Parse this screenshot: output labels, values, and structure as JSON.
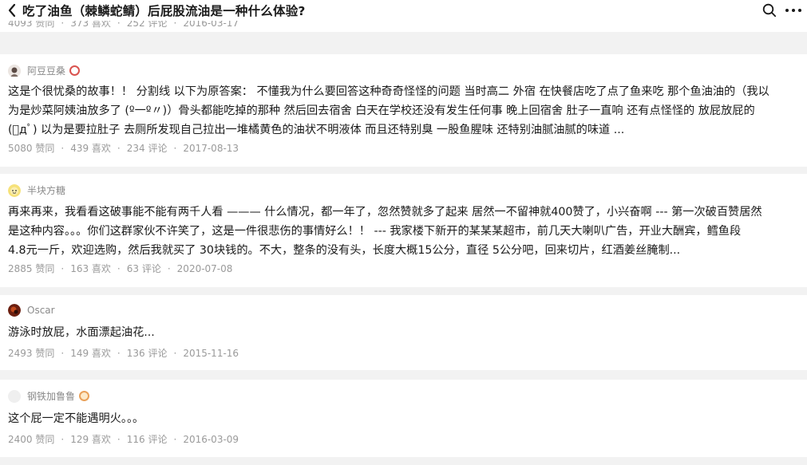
{
  "header": {
    "title": "吃了油鱼（棘鳞蛇鲭）后屁股流油是一种什么体验?",
    "back_icon": "chevron-left-icon",
    "search_icon": "search-icon",
    "more_icon": "more-horizontal-icon"
  },
  "previous_answer": {
    "upvotes": "4093 赞同",
    "likes": "373 喜欢",
    "comments": "252 评论",
    "date": "2016-03-17"
  },
  "answers": [
    {
      "author": "阿豆豆桑",
      "has_badge": true,
      "badge_color": "#d9534f",
      "lines": [
        "这是个很忧桑的故事！！ 分割线 以下为原答案： 不懂我为什么要回答这种奇奇怪怪的问题 当时高二 外宿 在快餐店吃了点了鱼来吃 那个鱼油油的（我以",
        "为是炒菜阿姨油放多了 (º一º〃)）骨头都能吃掉的那种 然后回去宿舍 白天在学校还没有发生任何事 晚上回宿舍 肚子一直响 还有点怪怪的 放屁放屁的",
        "(ﾟдﾟ) 以为是要拉肚子 去厕所发现自己拉出一堆橘黄色的油状不明液体 而且还特别臭 一股鱼腥味 还特别油腻油腻的味道 ..."
      ],
      "upvotes": "5080 赞同",
      "likes": "439 喜欢",
      "comments": "234 评论",
      "date": "2017-08-13"
    },
    {
      "author": "半块方糖",
      "has_badge": false,
      "lines": [
        "再来再来，我看看这破事能不能有两千人看 ——— 什么情况，都一年了，忽然赞就多了起来 居然一不留神就400赞了，小兴奋啊 --- 第一次破百赞居然",
        "是这种内容。。。你们这群家伙不许笑了，这是一件很悲伤的事情好么！！ --- 我家楼下新开的某某某超市，前几天大喇叭广告，开业大酬宾，鳕鱼段",
        "4.8元一斤，欢迎选购，然后我就买了 30块钱的。不大，整条的没有头，长度大概15公分，直径 5公分吧，回来切片，红酒姜丝腌制..."
      ],
      "upvotes": "2885 赞同",
      "likes": "163 喜欢",
      "comments": "63 评论",
      "date": "2020-07-08"
    },
    {
      "author": "Oscar",
      "has_badge": false,
      "lines": [
        "游泳时放屁，水面漂起油花..."
      ],
      "upvotes": "2493 赞同",
      "likes": "149 喜欢",
      "comments": "136 评论",
      "date": "2015-11-16"
    },
    {
      "author": "钢铁加鲁鲁",
      "has_badge": true,
      "badge_color": "#e9a15a",
      "lines": [
        "这个屁一定不能遇明火。。。"
      ],
      "upvotes": "2400 赞同",
      "likes": "129 喜欢",
      "comments": "116 评论",
      "date": "2016-03-09"
    }
  ]
}
